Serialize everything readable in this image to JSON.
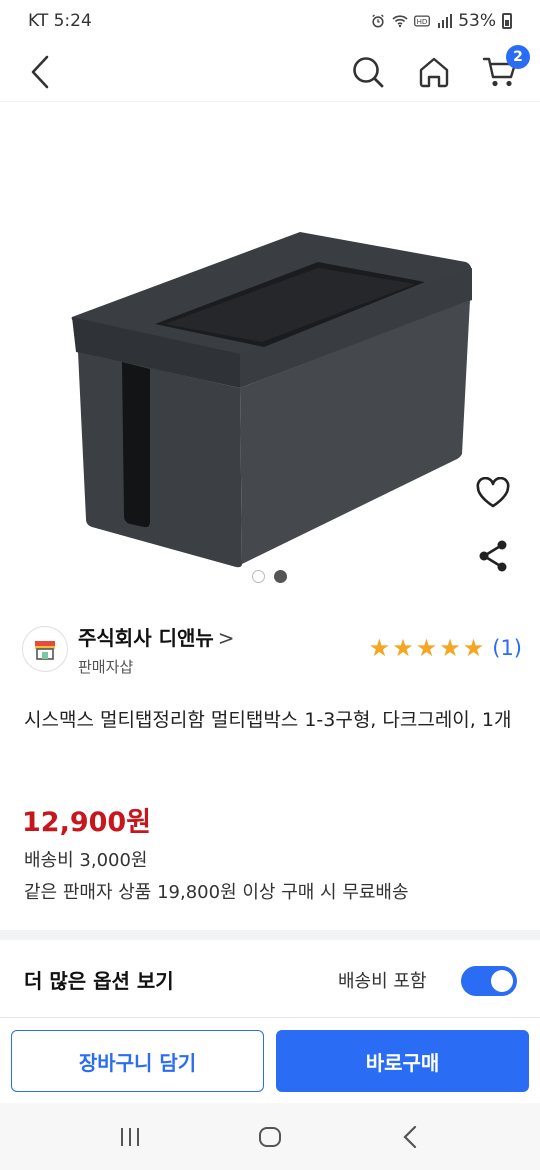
{
  "status_bar": {
    "carrier_time": "KT 5:24",
    "battery": "53%",
    "icons": [
      "alarm-icon",
      "wifi-icon",
      "hd-icon",
      "signal-icon",
      "battery-icon"
    ]
  },
  "nav": {
    "cart_count": "2",
    "icons": [
      "back-arrow-icon",
      "search-icon",
      "home-icon",
      "cart-icon"
    ]
  },
  "gallery": {
    "image_count": 2,
    "active_index": 1
  },
  "seller": {
    "name": "주식회사 디앤뉴",
    "chevron": ">",
    "type": "판매자샵",
    "rating_stars": 5,
    "review_count": "(1)"
  },
  "product": {
    "title": "시스맥스 멀티탭정리함 멀티탭박스 1-3구형, 다크그레이, 1개",
    "price": "12,900원",
    "shipping_fee": "배송비 3,000원",
    "free_shipping_note": "같은 판매자 상품 19,800원 이상 구매 시 무료배송"
  },
  "options": {
    "more_label": "더 많은 옵션 보기",
    "include_shipping_label": "배송비 포함",
    "include_shipping_on": true
  },
  "actions": {
    "add_to_cart": "장바구니 담기",
    "buy_now": "바로구매"
  },
  "colors": {
    "accent": "#2a6df4",
    "price": "#c8161d",
    "star": "#f5a623"
  }
}
